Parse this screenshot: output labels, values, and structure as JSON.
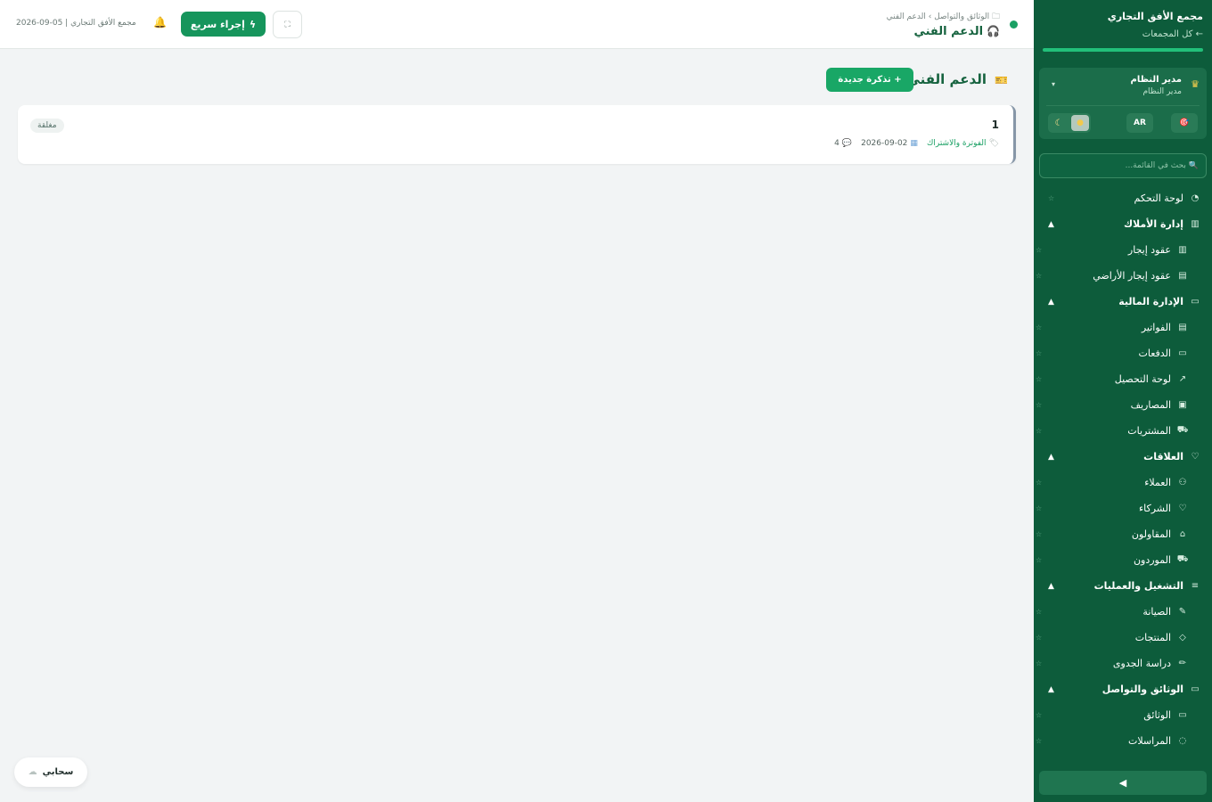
{
  "sidebar": {
    "brand_name": "مجمع الأفق التجاري",
    "all_complexes": "← كل المجمعات",
    "user": {
      "name": "مدير النظام",
      "role": "مدير النظام",
      "lang": "AR"
    },
    "search_placeholder": "🔍 بحث في القائمة...",
    "items": [
      {
        "label": "لوحة التحكم",
        "type": "top",
        "icon": "dashboard-icon"
      },
      {
        "label": "إدارة الأملاك",
        "type": "section",
        "icon": "building-icon"
      },
      {
        "label": "عقود إيجار",
        "type": "sub",
        "icon": "building-icon"
      },
      {
        "label": "عقود إيجار الأراضي",
        "type": "sub",
        "icon": "scroll-icon"
      },
      {
        "label": "الإدارة المالية",
        "type": "section",
        "icon": "wallet-icon"
      },
      {
        "label": "الفواتير",
        "type": "sub",
        "icon": "invoice-icon"
      },
      {
        "label": "الدفعات",
        "type": "sub",
        "icon": "card-icon"
      },
      {
        "label": "لوحة التحصيل",
        "type": "sub",
        "icon": "chart-icon"
      },
      {
        "label": "المصاريف",
        "type": "sub",
        "icon": "cash-icon"
      },
      {
        "label": "المشتريات",
        "type": "sub",
        "icon": "cart-icon"
      },
      {
        "label": "العلاقات",
        "type": "section",
        "icon": "handshake-icon"
      },
      {
        "label": "العملاء",
        "type": "sub",
        "icon": "users-icon"
      },
      {
        "label": "الشركاء",
        "type": "sub",
        "icon": "handshake-icon"
      },
      {
        "label": "المقاولون",
        "type": "sub",
        "icon": "helmet-icon"
      },
      {
        "label": "الموردون",
        "type": "sub",
        "icon": "truck-icon"
      },
      {
        "label": "التشغيل والعمليات",
        "type": "section",
        "icon": "sliders-icon"
      },
      {
        "label": "الصيانة",
        "type": "sub",
        "icon": "wrench-icon"
      },
      {
        "label": "المنتجات",
        "type": "sub",
        "icon": "tag-icon"
      },
      {
        "label": "دراسة الجدوى",
        "type": "sub",
        "icon": "pencil-icon"
      },
      {
        "label": "الوثائق والتواصل",
        "type": "section",
        "icon": "folder-icon"
      },
      {
        "label": "الوثائق",
        "type": "sub",
        "icon": "folder-icon"
      },
      {
        "label": "المراسلات",
        "type": "sub",
        "icon": "chat-icon"
      }
    ]
  },
  "header": {
    "breadcrumb": "الوثائق والتواصل › الدعم الفني",
    "title": "الدعم الفني",
    "quick_action": "إجراء سريع",
    "date_text": "2026-09-05 | مجمع الأفق التجاري"
  },
  "main": {
    "title": "الدعم الفني",
    "new_ticket": "+ تذكرة جديدة",
    "tickets": [
      {
        "id": "1",
        "category": "الفوترة والاشتراك",
        "date": "2026-09-02",
        "replies": "4",
        "status": "مغلقة"
      }
    ]
  },
  "footer": {
    "cloud_label": "سحابي"
  },
  "colors": {
    "sidebar_bg": "#0d5c3b",
    "accent": "#16955c",
    "status_dot": "#1aa064"
  }
}
